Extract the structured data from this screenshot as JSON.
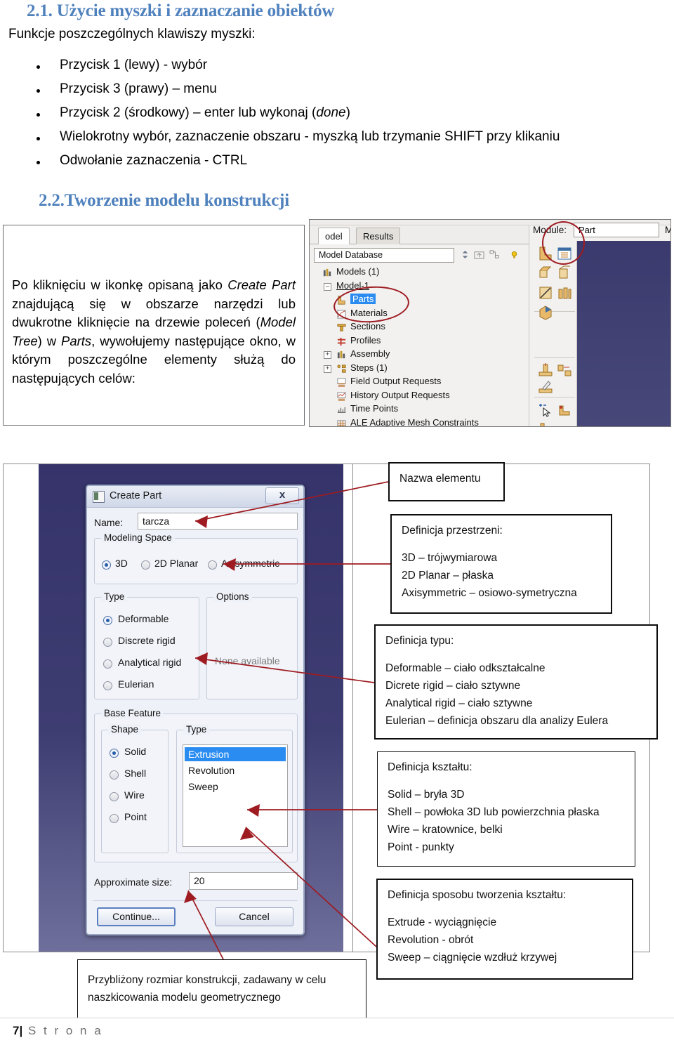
{
  "document": {
    "headings": {
      "section_2_1": "2.1. Użycie myszki i zaznaczanie obiektów",
      "section_2_2": "2.2.Tworzenie modelu konstrukcji"
    },
    "intro_line": "Funkcje poszczególnych klawiszy myszki:",
    "bullets": [
      "Przycisk 1 (lewy)  - wybór",
      "Przycisk  3 (prawy) – menu",
      "Przycisk 2 (środkowy) – enter lub wykonaj (done)",
      "Wielokrotny wybór, zaznaczenie obszaru - myszką lub trzymanie SHIFT przy klikaniu",
      "Odwołanie zaznaczenia - CTRL"
    ],
    "paragraph": "Po kliknięciu w ikonkę opisaną jako Create Part znajdującą się w obszarze narzędzi lub dwukrotne kliknięcie na drzewie poleceń (Model Tree) w Parts, wywołujemy następujące okno, w którym poszczególne elementy służą do następujących celów:",
    "footer": {
      "page_number": "7",
      "separator": "|",
      "label": "S t r o n a"
    }
  },
  "abaqus_panel": {
    "tabs": [
      {
        "label": "odel",
        "active": false
      },
      {
        "label": "Results",
        "active": false
      }
    ],
    "model_database_combo": "Model Database",
    "module_label": "Module:",
    "module_value": "Part",
    "module_after": "M",
    "tree": [
      {
        "label": "Models (1)",
        "level": 1,
        "icon": "models-icon",
        "expander": "none",
        "selected": false
      },
      {
        "label": "Model-1",
        "level": 1,
        "icon": "none",
        "expander": "minus",
        "selected": false
      },
      {
        "label": "Parts",
        "level": 2,
        "icon": "parts-icon",
        "expander": "none",
        "selected": true
      },
      {
        "label": "Materials",
        "level": 2,
        "icon": "materials-icon",
        "expander": "none",
        "selected": false
      },
      {
        "label": "Sections",
        "level": 2,
        "icon": "sections-icon",
        "expander": "none",
        "selected": false
      },
      {
        "label": "Profiles",
        "level": 2,
        "icon": "profiles-icon",
        "expander": "none",
        "selected": false
      },
      {
        "label": "Assembly",
        "level": 2,
        "icon": "assembly-icon",
        "expander": "plus",
        "selected": false
      },
      {
        "label": "Steps (1)",
        "level": 2,
        "icon": "steps-icon",
        "expander": "plus",
        "selected": false
      },
      {
        "label": "Field Output Requests",
        "level": 2,
        "icon": "field-output-icon",
        "expander": "none",
        "selected": false
      },
      {
        "label": "History Output Requests",
        "level": 2,
        "icon": "history-output-icon",
        "expander": "none",
        "selected": false
      },
      {
        "label": "Time Points",
        "level": 2,
        "icon": "time-points-icon",
        "expander": "none",
        "selected": false
      },
      {
        "label": "ALE Adaptive Mesh Constraints",
        "level": 2,
        "icon": "ale-mesh-icon",
        "expander": "none",
        "selected": false
      }
    ]
  },
  "create_part_dialog": {
    "title": "Create Part",
    "close_label": "x",
    "name_label": "Name:",
    "name_value": "tarcza",
    "modeling_space": {
      "title": "Modeling Space",
      "options": [
        {
          "label": "3D",
          "selected": true
        },
        {
          "label": "2D Planar",
          "selected": false
        },
        {
          "label": "Axisymmetric",
          "selected": false
        }
      ]
    },
    "type": {
      "title": "Type",
      "options": [
        {
          "label": "Deformable",
          "selected": true
        },
        {
          "label": "Discrete rigid",
          "selected": false
        },
        {
          "label": "Analytical rigid",
          "selected": false
        },
        {
          "label": "Eulerian",
          "selected": false
        }
      ]
    },
    "options_group": {
      "title": "Options",
      "text": "None available"
    },
    "base_feature": {
      "title": "Base Feature",
      "shape": {
        "title": "Shape",
        "options": [
          {
            "label": "Solid",
            "selected": true
          },
          {
            "label": "Shell",
            "selected": false
          },
          {
            "label": "Wire",
            "selected": false
          },
          {
            "label": "Point",
            "selected": false
          }
        ]
      },
      "type": {
        "title": "Type",
        "items": [
          {
            "label": "Extrusion",
            "selected": true
          },
          {
            "label": "Revolution",
            "selected": false
          },
          {
            "label": "Sweep",
            "selected": false
          }
        ]
      }
    },
    "approximate_size_label": "Approximate size:",
    "approximate_size_value": "20",
    "continue_button": "Continue...",
    "cancel_button": "Cancel"
  },
  "callouts": {
    "name": {
      "heading": "Nazwa elementu",
      "lines": []
    },
    "space": {
      "heading": "Definicja przestrzeni:",
      "lines": [
        "3D – trójwymiarowa",
        "2D Planar – płaska",
        "Axisymmetric – osiowo-symetryczna"
      ]
    },
    "type": {
      "heading": "Definicja typu:",
      "lines": [
        "Deformable – ciało odkształcalne",
        "Dicrete rigid – ciało sztywne",
        "Analytical rigid – ciało sztywne",
        "Eulerian – definicja obszaru dla analizy Eulera"
      ]
    },
    "shape": {
      "heading": "Definicja kształtu:",
      "lines": [
        "Solid – bryła 3D",
        "Shell – powłoka 3D lub powierzchnia płaska",
        "Wire – kratownice, belki",
        "Point - punkty"
      ]
    },
    "method": {
      "heading": "Definicja sposobu tworzenia kształtu:",
      "lines": [
        "Extrude - wyciągnięcie",
        "Revolution - obrót",
        "Sweep – ciągnięcie wzdłuż krzywej"
      ]
    },
    "size": {
      "line1": "Przybliżony rozmiar konstrukcji, zadawany w celu",
      "line2": "naszkicowania modelu geometrycznego"
    }
  },
  "colors": {
    "heading_blue": "#4f81bd",
    "annotation_red": "#9e1b21",
    "selection_blue": "#2a8cf0",
    "viewport_navy": "#3b3a6e"
  }
}
